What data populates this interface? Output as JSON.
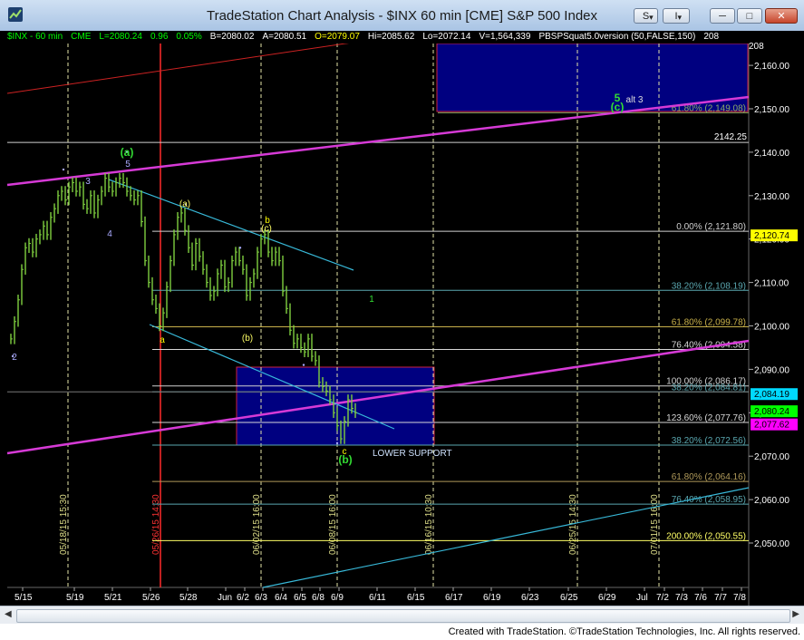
{
  "window": {
    "title": "TradeStation Chart Analysis - $INX 60 min [CME] S&P 500 Index",
    "buttons": {
      "s_label": "S",
      "tools_label": "I",
      "minimize_label": "─",
      "maximize_label": "□",
      "close_label": "✕"
    }
  },
  "info_bar": [
    {
      "text": "$INX - 60 min",
      "color": "#00ff00"
    },
    {
      "text": "CME",
      "color": "#00ff00"
    },
    {
      "text": "L=2080.24",
      "color": "#00ff00"
    },
    {
      "text": "0.96",
      "color": "#00ff00"
    },
    {
      "text": "0.05%",
      "color": "#00ff00"
    },
    {
      "text": "B=2080.02",
      "color": "#ffffff"
    },
    {
      "text": "A=2080.51",
      "color": "#ffffff"
    },
    {
      "text": "O=2079.07",
      "color": "#ffff00"
    },
    {
      "text": "Hi=2085.62",
      "color": "#ffffff"
    },
    {
      "text": "Lo=2072.14",
      "color": "#ffffff"
    },
    {
      "text": "V=1,564,339",
      "color": "#ffffff"
    },
    {
      "text": "PBSPSquat5.0version (50,FALSE,150)",
      "color": "#ffffff"
    },
    {
      "text": "208",
      "color": "#ffffff"
    }
  ],
  "footer": {
    "credit": "Created with TradeStation. ©TradeStation Technologies, Inc. All rights reserved."
  },
  "colors": {
    "price_bars": "#7fcf3f",
    "fib_line": "#bfbfbf",
    "channel": "#d63ad6",
    "trendline": "#38b9d9",
    "box_fill": "#000080",
    "box_border": "#cc2244"
  },
  "chart_data": {
    "type": "bar",
    "symbol": "$INX",
    "interval": "60 min",
    "y_range": [
      2042.7,
      2169.1
    ],
    "y_ticks": [
      "2,050.00",
      "2,060.00",
      "2,070.00",
      "2,080.00",
      "2,090.00",
      "2,100.00",
      "2,110.00",
      "2,120.00",
      "2,130.00",
      "2,140.00",
      "2,150.00",
      "2,160.00"
    ],
    "x_ticks": [
      "5/15",
      "5/19",
      "5/21",
      "5/26",
      "5/28",
      "Jun",
      "6/2",
      "6/3",
      "6/4",
      "6/5",
      "6/8",
      "6/9",
      "6/11",
      "6/15",
      "6/17",
      "6/19",
      "6/23",
      "6/25",
      "6/29",
      "Jul",
      "7/2",
      "7/3",
      "7/6",
      "7/7",
      "7/8"
    ],
    "price_badges": [
      {
        "text": "2,120.74",
        "value": 2120.74,
        "bg": "#ffff00",
        "fg": "#000000"
      },
      {
        "text": "2,084.19",
        "value": 2084.19,
        "bg": "#00d9ff",
        "fg": "#000000"
      },
      {
        "text": "2,080.24",
        "value": 2080.24,
        "bg": "#00ff00",
        "fg": "#000000"
      },
      {
        "text": "2,077.62",
        "value": 2077.62,
        "bg": "#ff00ff",
        "fg": "#000000"
      }
    ],
    "fib_levels": [
      {
        "label": "61.80% (2,149.08)",
        "value": 2149.08,
        "color": "#8aaa66"
      },
      {
        "label": "0.00% (2,121.80)",
        "value": 2121.8,
        "color": "#cfcfcf"
      },
      {
        "label": "38.20% (2,108.19)",
        "value": 2108.19,
        "color": "#5aa7b0"
      },
      {
        "label": "61.80% (2,099.78)",
        "value": 2099.78,
        "color": "#c8b04a"
      },
      {
        "label": "76.40% (2,094.58)",
        "value": 2094.58,
        "color": "#d8d8d8"
      },
      {
        "label": "100.00% (2,086.17)",
        "value": 2086.17,
        "color": "#d0d0d0"
      },
      {
        "label": "38.20% (2,084.81)",
        "value": 2084.81,
        "color": "#5aa7b0"
      },
      {
        "label": "123.60% (2,077.76)",
        "value": 2077.76,
        "color": "#d8d8d8"
      },
      {
        "label": "38.20% (2,072.56)",
        "value": 2072.56,
        "color": "#5aa7b0"
      },
      {
        "label": "61.80% (2,064.16)",
        "value": 2064.16,
        "color": "#b09a5a"
      },
      {
        "label": "76.40% (2,058.95)",
        "value": 2058.95,
        "color": "#5aa7b0"
      },
      {
        "label": "200.00% (2,050.55)",
        "value": 2050.55,
        "color": "#ffff66"
      }
    ],
    "level_labels": [
      {
        "text": "2142.25",
        "value": 2142.25
      }
    ],
    "vertical_time_labels": [
      {
        "text": "05/18/15 15:30",
        "color": "#dddd88"
      },
      {
        "text": "05/26/15 14:30",
        "color": "#ff3333"
      },
      {
        "text": "06/02/15 16:00",
        "color": "#dddd88"
      },
      {
        "text": "06/08/15 16:00",
        "color": "#dddd88"
      },
      {
        "text": "06/16/15 10:30",
        "color": "#dddd88"
      },
      {
        "text": "06/25/15 14:30",
        "color": "#dddd88"
      },
      {
        "text": "07/01/15 16:00",
        "color": "#dddd88"
      }
    ],
    "wave_labels": [
      {
        "text": "(a)",
        "color": "#33dd33"
      },
      {
        "text": "3",
        "color": "#aaaaff"
      },
      {
        "text": "5",
        "color": "#aaaaff"
      },
      {
        "text": "4",
        "color": "#aaaaff"
      },
      {
        "text": "2",
        "color": "#aaaaff"
      },
      {
        "text": "(a)",
        "color": "#ffff66"
      },
      {
        "text": "a",
        "color": "#ffff00"
      },
      {
        "text": "b",
        "color": "#ffff00"
      },
      {
        "text": "(c)",
        "color": "#ffff66"
      },
      {
        "text": "(b)",
        "color": "#ffff66"
      },
      {
        "text": "1",
        "color": "#33dd33"
      },
      {
        "text": "c",
        "color": "#ffff00"
      },
      {
        "text": "(b)",
        "color": "#33dd33"
      },
      {
        "text": "5",
        "color": "#33dd33"
      },
      {
        "text": "(c)",
        "color": "#33dd33"
      },
      {
        "text": "alt 3",
        "color": "#dddddd"
      }
    ],
    "annotations": [
      "LOWER SUPPORT"
    ]
  }
}
